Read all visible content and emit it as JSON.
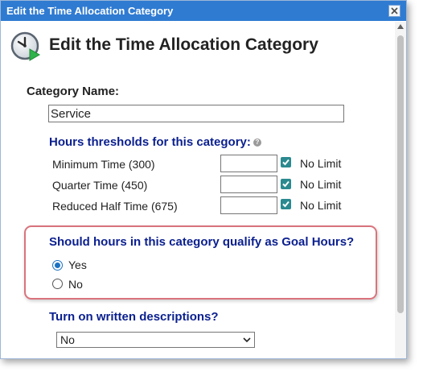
{
  "window": {
    "title": "Edit the Time Allocation Category",
    "close_icon": "close-icon"
  },
  "header": {
    "title": "Edit the Time Allocation Category",
    "icon": "clock-play-icon"
  },
  "category": {
    "label": "Category Name:",
    "value": "Service"
  },
  "thresholds": {
    "heading": "Hours thresholds for this category:",
    "help_icon": "help-icon",
    "rows": [
      {
        "label": "Minimum Time (300)",
        "value": "",
        "no_limit_label": "No Limit",
        "no_limit_checked": true
      },
      {
        "label": "Quarter Time (450)",
        "value": "",
        "no_limit_label": "No Limit",
        "no_limit_checked": true
      },
      {
        "label": "Reduced Half Time (675)",
        "value": "",
        "no_limit_label": "No Limit",
        "no_limit_checked": true
      }
    ]
  },
  "goal_hours": {
    "question": "Should hours in this category qualify as Goal Hours?",
    "options": [
      {
        "label": "Yes",
        "selected": true
      },
      {
        "label": "No",
        "selected": false
      }
    ]
  },
  "descriptions": {
    "question": "Turn on written descriptions?",
    "selected": "No"
  },
  "colors": {
    "titlebar": "#2f7bd2",
    "heading_blue": "#0a1f8f",
    "checkbox": "#2a8a8f",
    "highlight_border": "#d9737c"
  }
}
